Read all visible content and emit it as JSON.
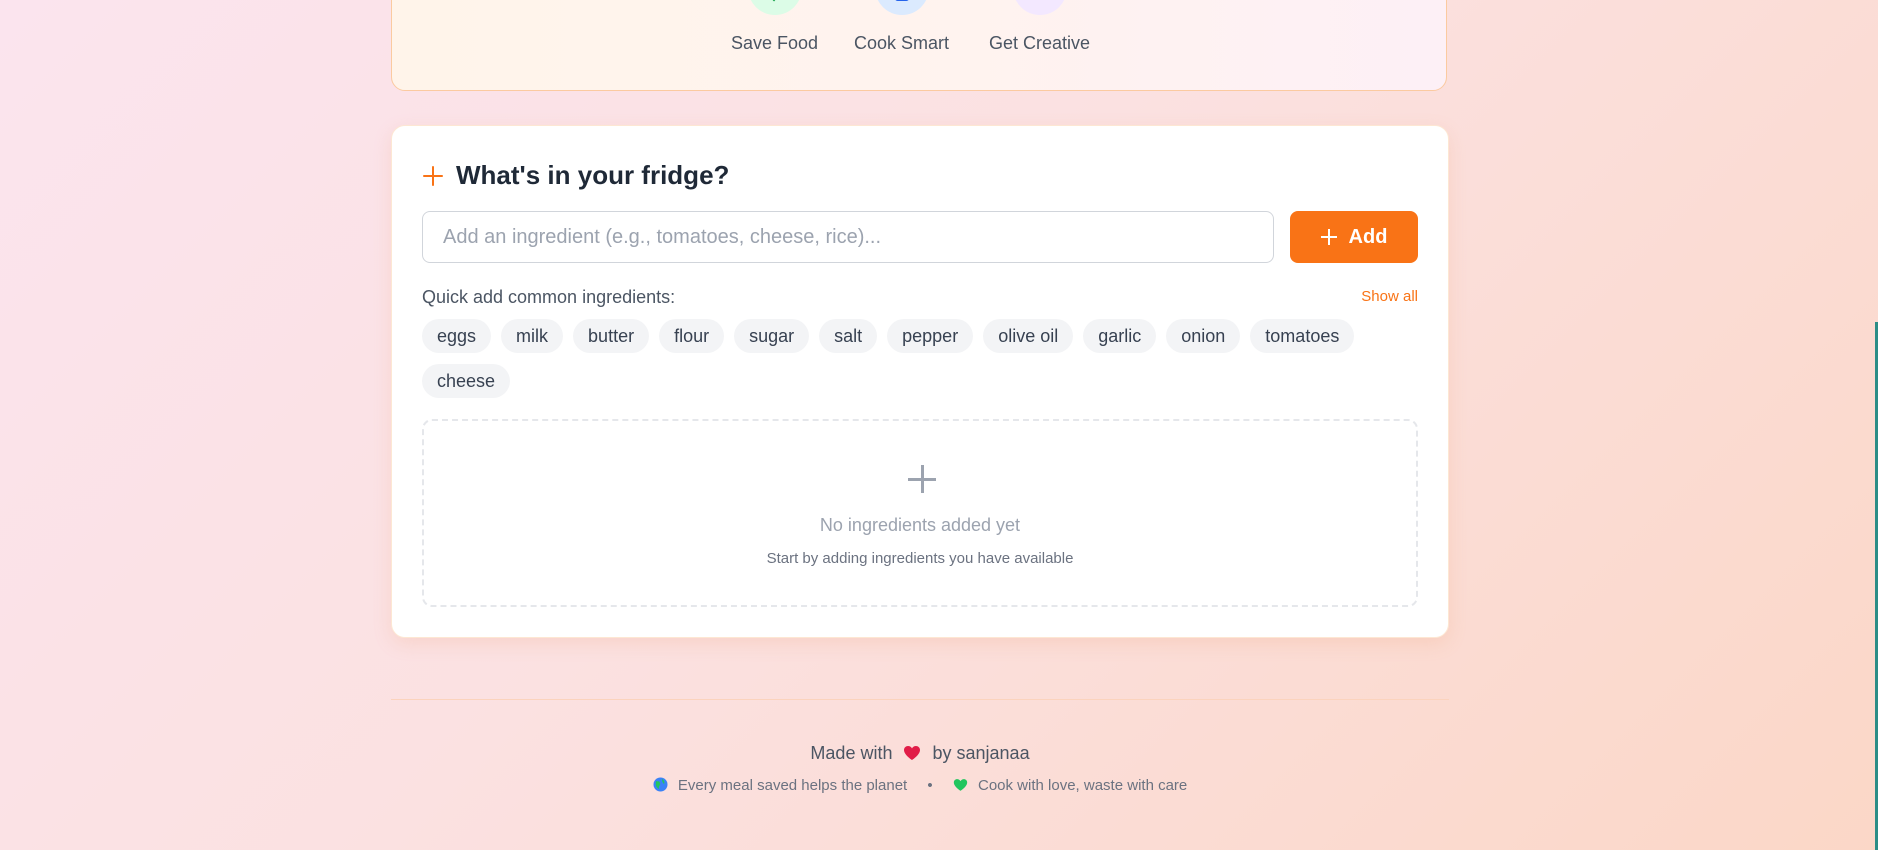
{
  "hero": {
    "features": [
      {
        "label": "Save Food",
        "icon": "check-icon",
        "color": "#dcfce7",
        "glyph_color": "#16a34a"
      },
      {
        "label": "Cook Smart",
        "icon": "book-icon",
        "color": "#dbeafe",
        "glyph_color": "#2563eb"
      },
      {
        "label": "Get Creative",
        "icon": "lightbulb-icon",
        "color": "#f3e8ff",
        "glyph_color": "#9333ea"
      }
    ]
  },
  "fridge": {
    "title": "What's in your fridge?",
    "input_placeholder": "Add an ingredient (e.g., tomatoes, cheese, rice)...",
    "input_value": "",
    "add_label": "Add",
    "quick_label": "Quick add common ingredients:",
    "show_all_label": "Show all",
    "chips": [
      "eggs",
      "milk",
      "butter",
      "flour",
      "sugar",
      "salt",
      "pepper",
      "olive oil",
      "garlic",
      "onion",
      "tomatoes",
      "cheese"
    ],
    "empty_title": "No ingredients added yet",
    "empty_subtitle": "Start by adding ingredients you have available"
  },
  "footer": {
    "made_with": "Made with",
    "by": "by sanjanaa",
    "tagline_1": "Every meal saved helps the planet",
    "separator": "•",
    "tagline_2": "Cook with love, waste with care"
  },
  "colors": {
    "accent": "#f97316",
    "heart": "#e11d48"
  }
}
